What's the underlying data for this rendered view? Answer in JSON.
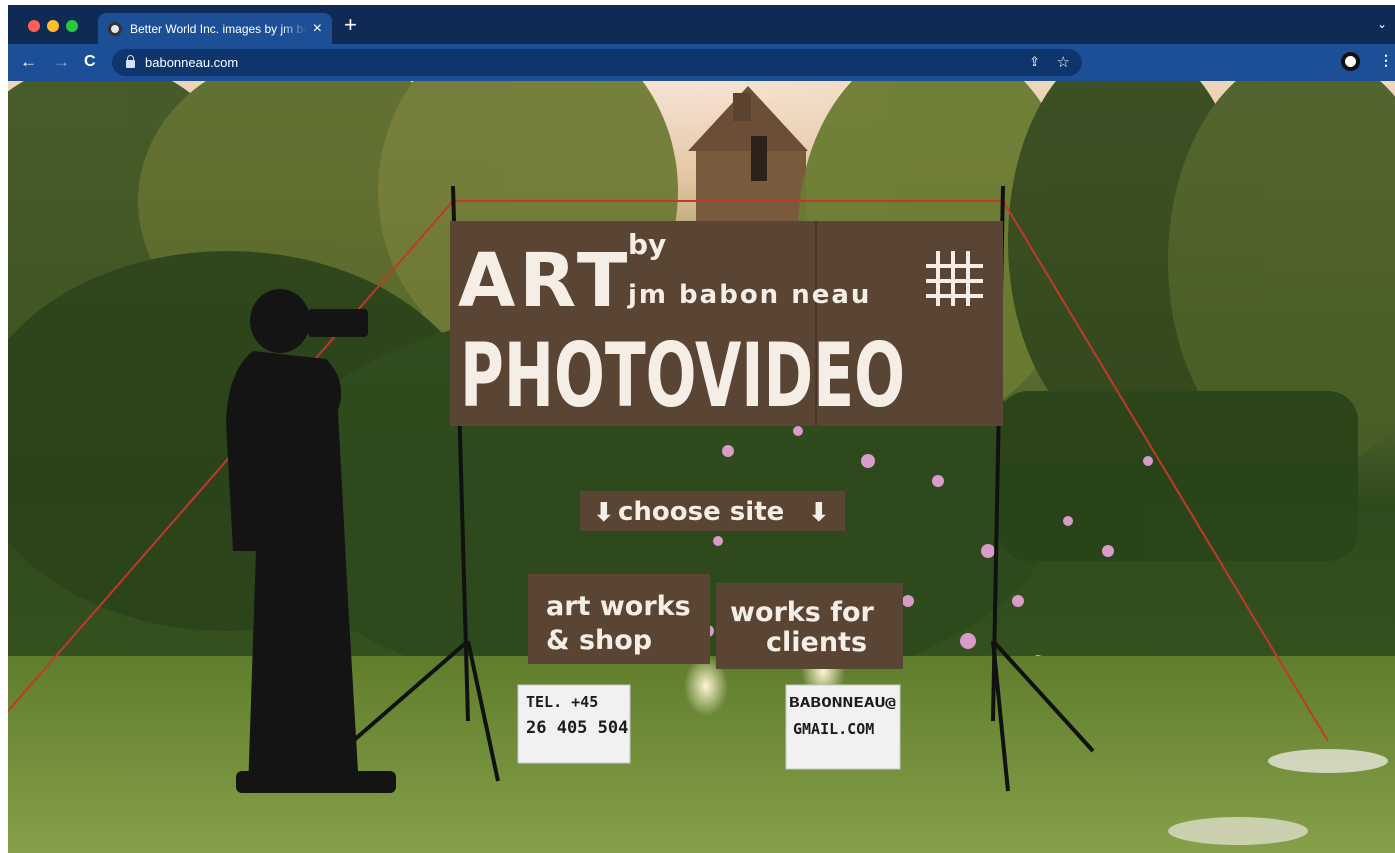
{
  "browser": {
    "tab_title": "Better World Inc. images by jm babonneau",
    "tab_close": "×",
    "new_tab": "+",
    "tab_dropdown": "⌄",
    "url": "babonneau.com",
    "icons": [
      "back-icon",
      "forward-icon",
      "reload-icon",
      "lock-icon",
      "share-icon",
      "star-icon",
      "profile-icon",
      "menu-icon"
    ]
  },
  "page": {
    "sign_main": {
      "line1": "ART",
      "by": "by",
      "author": "jm babon neau",
      "line2": "PHOTOVIDEO"
    },
    "choose_site": "choose site",
    "links": {
      "art_line1": "art works",
      "art_line2": "& shop",
      "clients_line1": "works for",
      "clients_line2": "clients"
    },
    "tel_box": {
      "line1": "TEL.   +45",
      "line2": "26 405 504"
    },
    "email_box": {
      "line1": "BABONNEAU@",
      "line2": "GMAIL.COM"
    }
  },
  "colors": {
    "tabstrip": "#0e2a55",
    "toolbar": "#1c4f95",
    "omnibox": "#0f366c",
    "sign_brown": "#5a4433",
    "sign_text": "#f4eee6"
  }
}
